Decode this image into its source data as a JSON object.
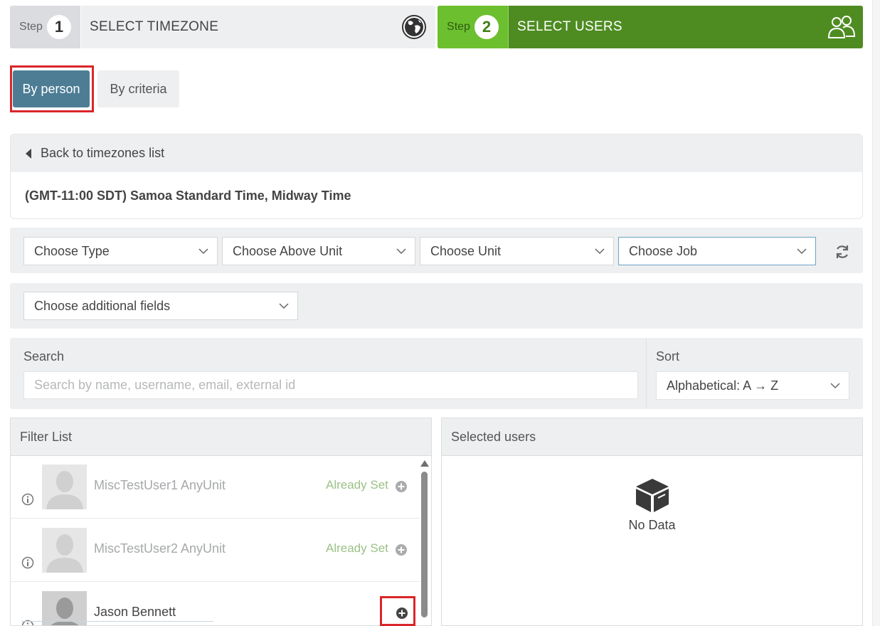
{
  "steps": [
    {
      "prefix": "Step",
      "number": "1",
      "title": "SELECT TIMEZONE",
      "icon": "globe-icon"
    },
    {
      "prefix": "Step",
      "number": "2",
      "title": "SELECT USERS",
      "icon": "users-icon"
    }
  ],
  "mode": {
    "by_person": "By person",
    "by_criteria": "By criteria",
    "selected": "By person"
  },
  "timezone": {
    "back_label": "Back to timezones list",
    "name": "(GMT-11:00 SDT) Samoa Standard Time, Midway Time"
  },
  "filters": {
    "type": "Choose Type",
    "above_unit": "Choose Above Unit",
    "unit": "Choose Unit",
    "job": "Choose Job",
    "additional_fields": "Choose additional fields"
  },
  "search": {
    "label": "Search",
    "placeholder": "Search by name, username, email, external id",
    "value": ""
  },
  "sort": {
    "label": "Sort",
    "value": "Alphabetical: A → Z"
  },
  "filter_list": {
    "title": "Filter List",
    "users": [
      {
        "name": "MiscTestUser1 AnyUnit",
        "status": "Already Set"
      },
      {
        "name": "MiscTestUser2 AnyUnit",
        "status": "Already Set"
      },
      {
        "name": "Jason Bennett",
        "status": ""
      }
    ]
  },
  "selected_users": {
    "title": "Selected users",
    "empty_text": "No Data"
  },
  "colors": {
    "active_step": "#4e8c22",
    "selected_mode": "#4d7d95",
    "highlight": "#d9262a",
    "already_set": "#9bc186"
  }
}
